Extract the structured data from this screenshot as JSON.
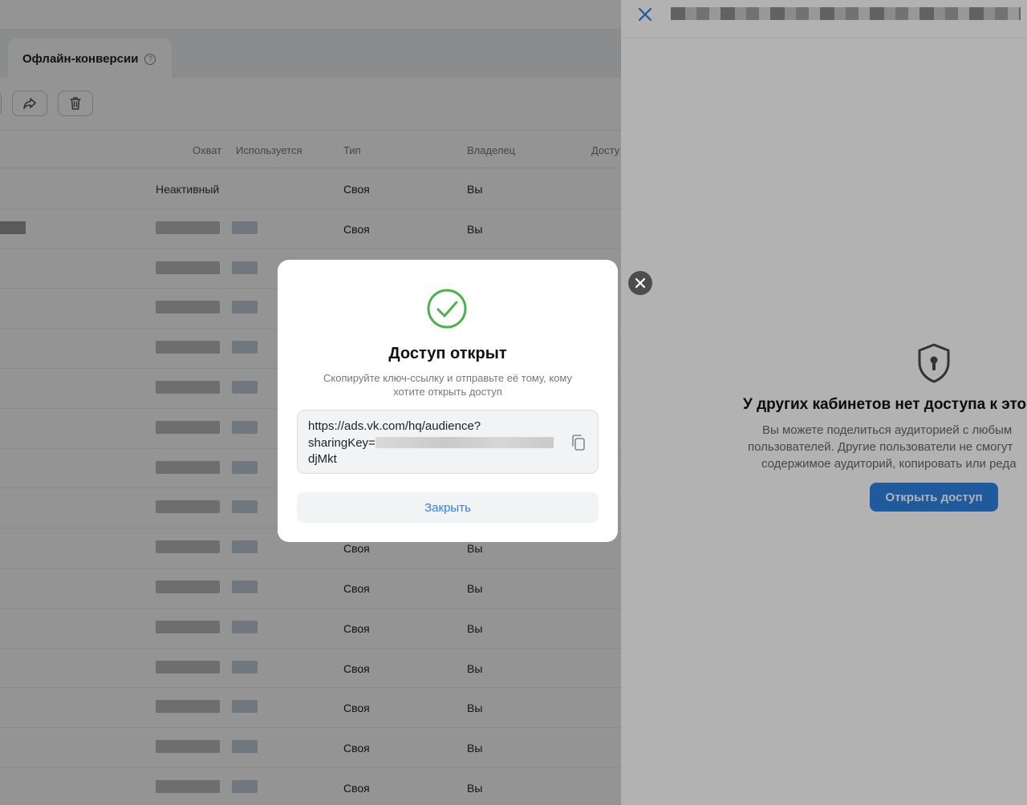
{
  "tabs": {
    "offline_label": "Офлайн-конверсии",
    "help": "?"
  },
  "table": {
    "headers": [
      "Охват",
      "Используется",
      "Тип",
      "Владелец",
      "Досту"
    ],
    "rows": [
      {
        "status": "Неактивный",
        "type": "Своя",
        "owner": "Вы"
      },
      {
        "status": "",
        "type": "Своя",
        "owner": "Вы"
      },
      {
        "status": "",
        "type": "",
        "owner": ""
      },
      {
        "status": "",
        "type": "",
        "owner": ""
      },
      {
        "status": "",
        "type": "",
        "owner": ""
      },
      {
        "status": "",
        "type": "",
        "owner": ""
      },
      {
        "status": "",
        "type": "",
        "owner": ""
      },
      {
        "status": "",
        "type": "",
        "owner": ""
      },
      {
        "status": "",
        "type": "",
        "owner": ""
      },
      {
        "status": "",
        "type": "Своя",
        "owner": "Вы"
      },
      {
        "status": "",
        "type": "Своя",
        "owner": "Вы"
      },
      {
        "status": "",
        "type": "Своя",
        "owner": "Вы"
      },
      {
        "status": "",
        "type": "Своя",
        "owner": "Вы"
      },
      {
        "status": "",
        "type": "Своя",
        "owner": "Вы"
      },
      {
        "status": "",
        "type": "Своя",
        "owner": "Вы"
      },
      {
        "status": "",
        "type": "Своя",
        "owner": "Вы"
      }
    ]
  },
  "panel": {
    "heading": "У других кабинетов нет доступа к это",
    "description": [
      "Вы можете поделиться аудиторией с любым",
      "пользователей. Другие пользователи не смогут",
      "содержимое аудиторий, копировать или реда"
    ],
    "open_access_button": "Открыть доступ"
  },
  "modal": {
    "title": "Доступ открыт",
    "description": "Скопируйте ключ-ссылку и отправьте её тому, кому хотите открыть доступ",
    "link_line1": "https://ads.vk.com/hq/audience?",
    "link_prefix": "sharingKey=",
    "link_suffix": "djMkt",
    "close_button": "Закрыть"
  },
  "colors": {
    "accent": "#2d81e0",
    "success": "#4bb34b"
  }
}
